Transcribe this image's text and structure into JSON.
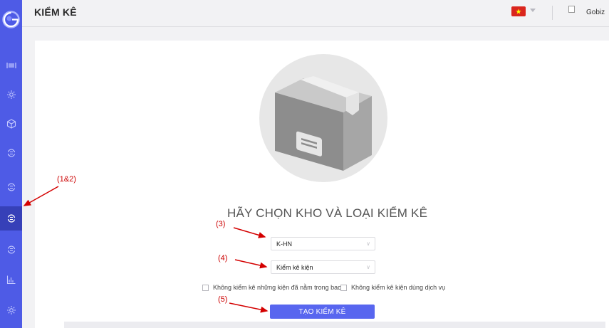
{
  "header": {
    "title": "KIỂM KÊ",
    "user_name": "Gobiz"
  },
  "sidebar": {
    "items": [
      {
        "icon": "barcode-scan-icon"
      },
      {
        "icon": "settings-sun-icon"
      },
      {
        "icon": "package-icon"
      },
      {
        "icon": "sync-icon"
      },
      {
        "icon": "sync-icon"
      },
      {
        "icon": "sync-icon",
        "active": true
      },
      {
        "icon": "sync-icon"
      },
      {
        "icon": "bar-chart-icon"
      },
      {
        "icon": "settings-sun-icon"
      }
    ]
  },
  "main": {
    "heading": "HÃY CHỌN KHO VÀ LOẠI KIỂM KÊ",
    "warehouse_select": {
      "value": "K-HN"
    },
    "type_select": {
      "value": "Kiểm kê kiện"
    },
    "checkbox_exclude_in_bag": {
      "label": "Không kiểm kê những kiện đã nằm trong bao",
      "checked": false
    },
    "checkbox_exclude_service": {
      "label": "Không kiểm kê kiện dùng dịch vụ",
      "checked": false
    },
    "create_button": "TẠO KIỂM KÊ"
  },
  "annotations": {
    "a1": "(1&2)",
    "a3": "(3)",
    "a4": "(4)",
    "a5": "(5)"
  },
  "colors": {
    "sidebar": "#4e5be6",
    "sidebar_active": "#3640b8",
    "primary": "#5866ef",
    "annotation": "#cc0000"
  }
}
